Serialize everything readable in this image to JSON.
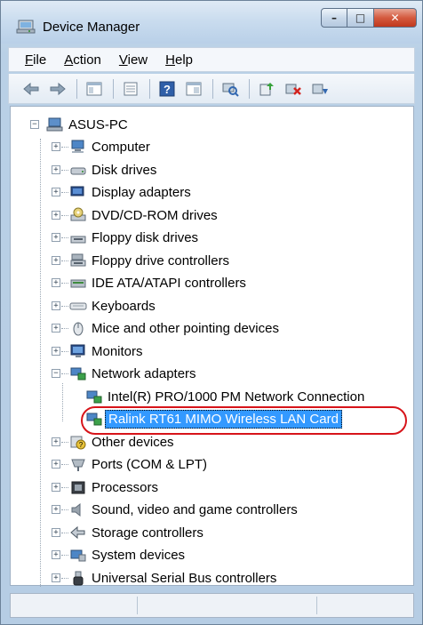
{
  "window": {
    "title": "Device Manager",
    "caption_buttons": {
      "minimize": "–",
      "maximize": "□",
      "close": "✕"
    }
  },
  "menu": [
    {
      "label": "File",
      "accel": "F",
      "rest": "ile"
    },
    {
      "label": "Action",
      "accel": "A",
      "rest": "ction"
    },
    {
      "label": "View",
      "accel": "V",
      "rest": "iew"
    },
    {
      "label": "Help",
      "accel": "H",
      "rest": "elp"
    }
  ],
  "toolbar": {
    "buttons": [
      "back-icon",
      "forward-icon",
      "show-hide-tree-icon",
      "properties-icon",
      "help-icon",
      "view-icon",
      "scan-hardware-icon",
      "update-driver-icon",
      "uninstall-icon",
      "disable-icon"
    ]
  },
  "tree": {
    "root": "ASUS-PC",
    "categories": [
      {
        "label": "Computer",
        "icon": "computer-icon"
      },
      {
        "label": "Disk drives",
        "icon": "disk-drive-icon"
      },
      {
        "label": "Display adapters",
        "icon": "display-adapter-icon"
      },
      {
        "label": "DVD/CD-ROM drives",
        "icon": "dvd-drive-icon"
      },
      {
        "label": "Floppy disk drives",
        "icon": "floppy-drive-icon"
      },
      {
        "label": "Floppy drive controllers",
        "icon": "floppy-controller-icon"
      },
      {
        "label": "IDE ATA/ATAPI controllers",
        "icon": "ide-controller-icon"
      },
      {
        "label": "Keyboards",
        "icon": "keyboard-icon"
      },
      {
        "label": "Mice and other pointing devices",
        "icon": "mouse-icon"
      },
      {
        "label": "Monitors",
        "icon": "monitor-icon"
      },
      {
        "label": "Network adapters",
        "icon": "network-adapter-icon",
        "expanded": true,
        "children": [
          {
            "label": "Intel(R) PRO/1000 PM Network Connection",
            "icon": "network-card-icon"
          },
          {
            "label": "Ralink RT61 MIMO Wireless LAN Card",
            "icon": "network-card-icon",
            "selected": true
          }
        ]
      },
      {
        "label": "Other devices",
        "icon": "unknown-device-icon"
      },
      {
        "label": "Ports (COM & LPT)",
        "icon": "port-icon"
      },
      {
        "label": "Processors",
        "icon": "processor-icon"
      },
      {
        "label": "Sound, video and game controllers",
        "icon": "speaker-icon"
      },
      {
        "label": "Storage controllers",
        "icon": "storage-controller-icon"
      },
      {
        "label": "System devices",
        "icon": "system-devices-icon"
      },
      {
        "label": "Universal Serial Bus controllers",
        "icon": "usb-icon"
      }
    ]
  },
  "colors": {
    "selection": "#3399ff",
    "annotation_oval": "#d7141a",
    "window_frame": "#b9d0e8"
  }
}
